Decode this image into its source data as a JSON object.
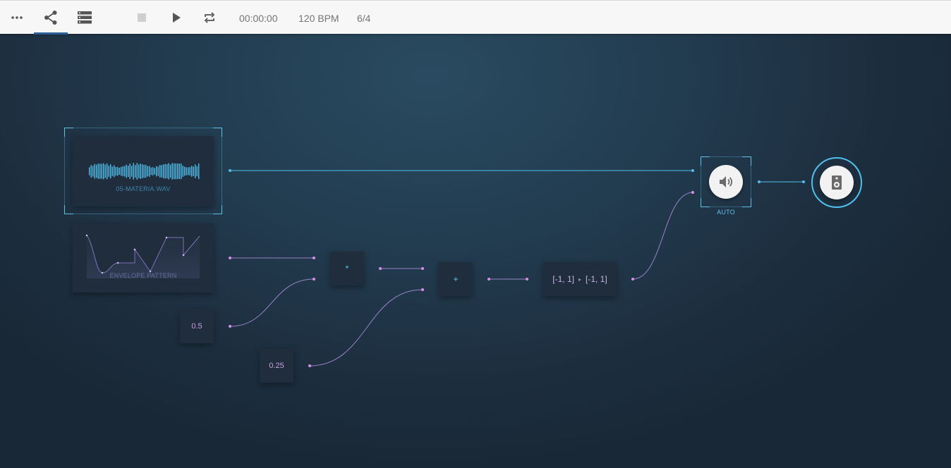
{
  "toolbar": {
    "menu_icon": "more-horizontal-icon",
    "graph_icon": "share-graph-icon",
    "tracks_icon": "tracks-list-icon",
    "stop_icon": "stop-icon",
    "play_icon": "play-icon",
    "loop_icon": "loop-icon",
    "time": "00:00:00",
    "tempo": "120 BPM",
    "meter": "6/4",
    "active_tab_color": "#2c5f93"
  },
  "nodes": {
    "audio_file": {
      "label": "05-MATERIA.WAV",
      "icon": "waveform-icon"
    },
    "envelope": {
      "label": "ENVELOPE PATTERN",
      "icon": "envelope-curve-icon"
    },
    "const_a": {
      "value": "0.5"
    },
    "const_b": {
      "value": "0.25"
    },
    "multiply": {
      "label": "*"
    },
    "add": {
      "label": "+"
    },
    "range_map": {
      "from": "[-1, 1]",
      "arrow": "▸",
      "to": "[-1, 1]"
    },
    "gain": {
      "label": "AUTO",
      "icon": "volume-icon"
    },
    "output": {
      "icon": "speaker-icon"
    }
  },
  "colors": {
    "audio_wire": "#4fc0ec",
    "control_wire": "#9a82c8",
    "control_port": "#d58fe8",
    "node_bg": "#1f2d3c",
    "waveform": "#4fc3f0"
  }
}
